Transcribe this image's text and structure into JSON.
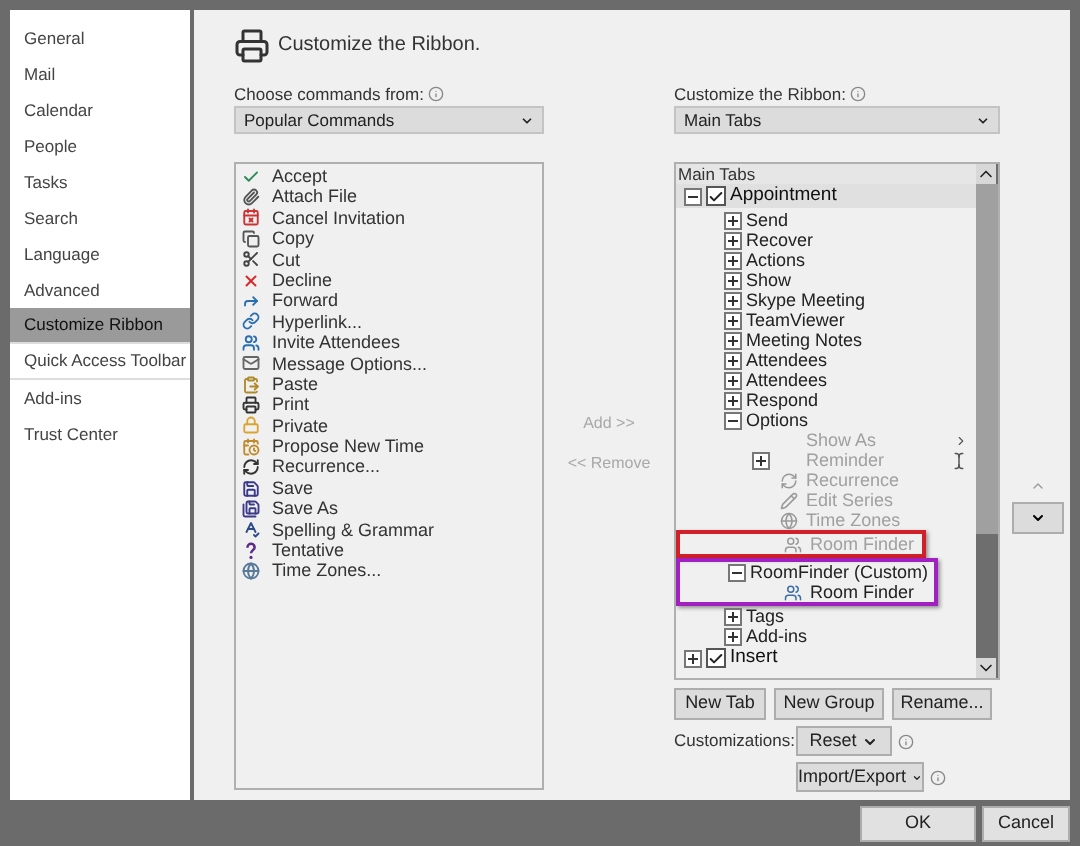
{
  "sidebar": {
    "items": [
      {
        "label": "General",
        "selected": false
      },
      {
        "label": "Mail",
        "selected": false
      },
      {
        "label": "Calendar",
        "selected": false
      },
      {
        "label": "People",
        "selected": false
      },
      {
        "label": "Tasks",
        "selected": false
      },
      {
        "label": "Search",
        "selected": false
      },
      {
        "label": "Language",
        "selected": false
      },
      {
        "label": "Advanced",
        "selected": false
      },
      {
        "label": "Customize Ribbon",
        "selected": true
      },
      {
        "label": "Quick Access Toolbar",
        "selected": false
      },
      {
        "label": "Add-ins",
        "selected": false
      },
      {
        "label": "Trust Center",
        "selected": false
      }
    ]
  },
  "header": {
    "title": "Customize the Ribbon."
  },
  "commands": {
    "label": "Choose commands from:",
    "dropdown": "Popular Commands",
    "items": [
      "Accept",
      "Attach File",
      "Cancel Invitation",
      "Copy",
      "Cut",
      "Decline",
      "Forward",
      "Hyperlink...",
      "Invite Attendees",
      "Message Options...",
      "Paste",
      "Print",
      "Private",
      "Propose New Time",
      "Recurrence...",
      "Save",
      "Save As",
      "Spelling & Grammar",
      "Tentative",
      "Time Zones..."
    ]
  },
  "transfer": {
    "add": {
      "label": "Add >>",
      "disabled": true
    },
    "remove": {
      "label": "<< Remove",
      "disabled": true
    }
  },
  "ribbon": {
    "label": "Customize the Ribbon:",
    "dropdown": "Main Tabs",
    "tree_header": "Main Tabs",
    "tree": [
      {
        "label": "Appointment",
        "checked": true,
        "expanded": true,
        "children": [
          {
            "label": "Send",
            "expanded": false
          },
          {
            "label": "Recover",
            "expanded": false
          },
          {
            "label": "Actions",
            "expanded": false
          },
          {
            "label": "Show",
            "expanded": false
          },
          {
            "label": "Skype Meeting",
            "expanded": false
          },
          {
            "label": "TeamViewer",
            "expanded": false
          },
          {
            "label": "Meeting Notes",
            "expanded": false
          },
          {
            "label": "Attendees",
            "expanded": false
          },
          {
            "label": "Attendees",
            "expanded": false
          },
          {
            "label": "Respond",
            "expanded": false
          },
          {
            "label": "Options",
            "expanded": true,
            "children": [
              {
                "label": "Show As",
                "disabled": true
              },
              {
                "label": "Reminder",
                "disabled": true,
                "expanded": false
              },
              {
                "label": "Recurrence",
                "disabled": true
              },
              {
                "label": "Edit Series",
                "disabled": true
              },
              {
                "label": "Time Zones",
                "disabled": true
              },
              {
                "label": "Room Finder",
                "disabled": true,
                "color": "#d0202a"
              }
            ]
          },
          {
            "label": "RoomFinder (Custom)",
            "expanded": true,
            "color": "#a020c0",
            "children": [
              {
                "label": "Room Finder",
                "disabled": false
              }
            ]
          },
          {
            "label": "Tags",
            "expanded": false
          },
          {
            "label": "Add-ins",
            "expanded": false
          }
        ]
      },
      {
        "label": "Insert",
        "checked": true,
        "expanded": false
      }
    ],
    "buttons": [
      "New Tab",
      "New Group",
      "Rename..."
    ],
    "customizations_label": "Customizations:",
    "reset": "Reset",
    "import_export": "Import/Export"
  },
  "footer": {
    "ok": "OK",
    "cancel": "Cancel"
  }
}
